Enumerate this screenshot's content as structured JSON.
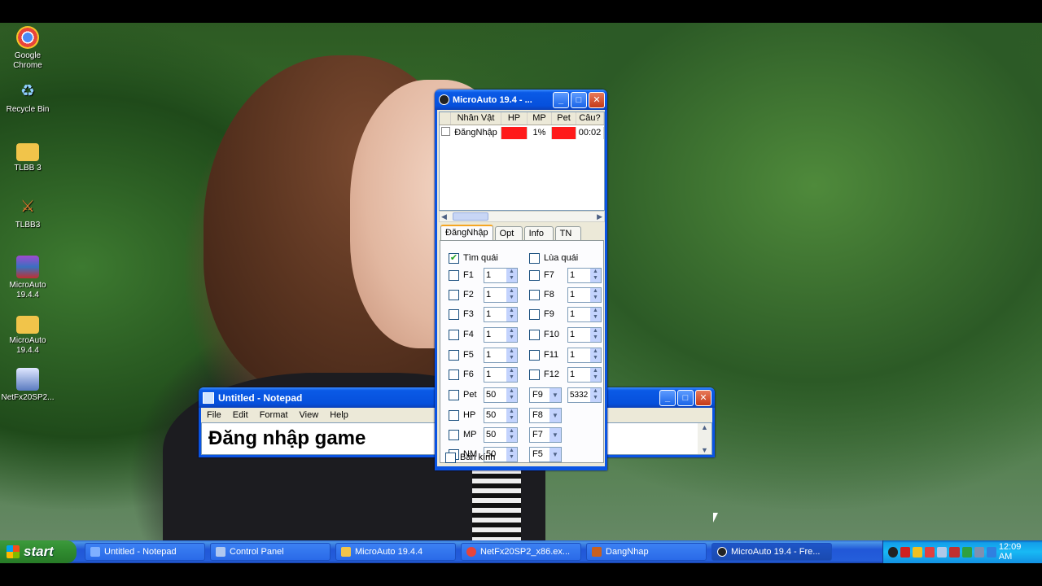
{
  "desktop": {
    "icons": [
      {
        "label": "Google\nChrome",
        "icon": "chrome-icon",
        "color": "#e8443a"
      },
      {
        "label": "Recycle Bin",
        "icon": "recycle-bin-icon",
        "color": "#4aa0e0"
      },
      {
        "label": "TLBB 3",
        "icon": "folder-icon",
        "color": "#f1c44a"
      },
      {
        "label": "TLBB3",
        "icon": "game-icon",
        "color": "#c86020"
      },
      {
        "label": "MicroAuto\n19.4.4",
        "icon": "winrar-icon",
        "color": "#7a3aa0"
      },
      {
        "label": "MicroAuto\n19.4.4",
        "icon": "folder-icon",
        "color": "#f1c44a"
      },
      {
        "label": "NetFx20SP2...",
        "icon": "installer-icon",
        "color": "#5a7ac0"
      }
    ]
  },
  "notepad": {
    "title": "Untitled - Notepad",
    "menu": [
      "File",
      "Edit",
      "Format",
      "View",
      "Help"
    ],
    "content": "Đăng nhập game"
  },
  "microauto": {
    "title": "MicroAuto 19.4 - ...",
    "columns": [
      "Nhân Vật",
      "HP",
      "MP",
      "Pet",
      "Câu?"
    ],
    "row": {
      "name": "ĐăngNhập",
      "hp": "1%",
      "mp": "1%",
      "pet": "0%",
      "time": "00:02"
    },
    "tabs": [
      "ĐăngNhập",
      "Opt",
      "Info",
      "TN"
    ],
    "tim_quai": "Tìm quái",
    "lua_quai": "Lùa quái",
    "fkeys_left": [
      {
        "label": "F1",
        "value": "1"
      },
      {
        "label": "F2",
        "value": "1"
      },
      {
        "label": "F3",
        "value": "1"
      },
      {
        "label": "F4",
        "value": "1"
      },
      {
        "label": "F5",
        "value": "1"
      },
      {
        "label": "F6",
        "value": "1"
      }
    ],
    "fkeys_right": [
      {
        "label": "F7",
        "value": "1"
      },
      {
        "label": "F8",
        "value": "1"
      },
      {
        "label": "F9",
        "value": "1"
      },
      {
        "label": "F10",
        "value": "1"
      },
      {
        "label": "F11",
        "value": "1"
      },
      {
        "label": "F12",
        "value": "1"
      }
    ],
    "items": [
      {
        "label": "Pet",
        "value": "50",
        "key": "F9",
        "extra": "5332"
      },
      {
        "label": "HP",
        "value": "50",
        "key": "F8"
      },
      {
        "label": "MP",
        "value": "50",
        "key": "F7"
      },
      {
        "label": "NM",
        "value": "50",
        "key": "F5"
      }
    ],
    "ban_kinh": "Bán kính"
  },
  "taskbar": {
    "start": "start",
    "tasks": [
      {
        "label": "Untitled - Notepad",
        "icon": "notepad-icon",
        "color": "#7fb0ff"
      },
      {
        "label": "Control Panel",
        "icon": "control-panel-icon",
        "color": "#b0c8f0"
      },
      {
        "label": "MicroAuto 19.4.4",
        "icon": "folder-icon",
        "color": "#f1c44a"
      },
      {
        "label": "NetFx20SP2_x86.ex...",
        "icon": "chrome-icon",
        "color": "#e8443a"
      },
      {
        "label": "DangNhap",
        "icon": "game-icon",
        "color": "#c86020"
      },
      {
        "label": "MicroAuto 19.4 - Fre...",
        "icon": "microauto-icon",
        "color": "#222222"
      }
    ],
    "clock": "12:09 AM"
  }
}
